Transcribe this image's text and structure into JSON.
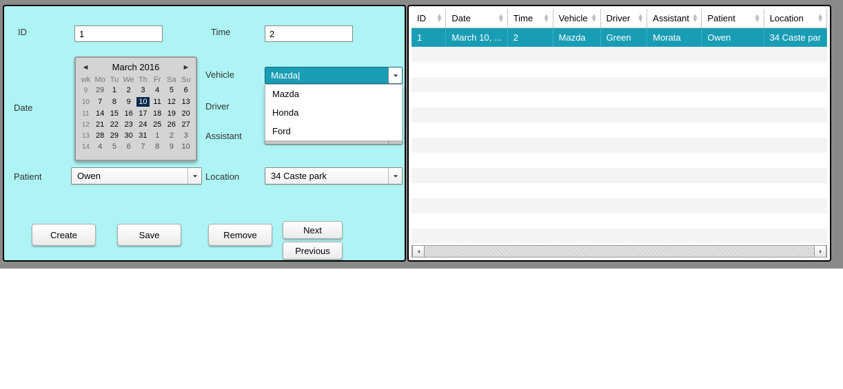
{
  "fields": {
    "id": {
      "label": "ID",
      "value": "1"
    },
    "time": {
      "label": "Time",
      "value": "2"
    },
    "date": {
      "label": "Date"
    },
    "vehicle": {
      "label": "Vehicle",
      "value": "Mazda"
    },
    "driver": {
      "label": "Driver"
    },
    "assistant": {
      "label": "Assistant",
      "value": "Morata"
    },
    "patient": {
      "label": "Patient",
      "value": "Owen"
    },
    "location": {
      "label": "Location",
      "value": "34 Caste park"
    }
  },
  "vehicle_options": [
    "Mazda",
    "Honda",
    "Ford"
  ],
  "calendar": {
    "title": "March 2016",
    "dow": [
      "wk",
      "Mo",
      "Tu",
      "We",
      "Th",
      "Fr",
      "Sa",
      "Su"
    ],
    "rows": [
      {
        "wk": "9",
        "d": [
          "29",
          "1",
          "2",
          "3",
          "4",
          "5",
          "6"
        ],
        "out": [
          0
        ]
      },
      {
        "wk": "10",
        "d": [
          "7",
          "8",
          "9",
          "10",
          "11",
          "12",
          "13"
        ],
        "sel": 3
      },
      {
        "wk": "11",
        "d": [
          "14",
          "15",
          "16",
          "17",
          "18",
          "19",
          "20"
        ]
      },
      {
        "wk": "12",
        "d": [
          "21",
          "22",
          "23",
          "24",
          "25",
          "26",
          "27"
        ]
      },
      {
        "wk": "13",
        "d": [
          "28",
          "29",
          "30",
          "31",
          "1",
          "2",
          "3"
        ],
        "out": [
          4,
          5,
          6
        ]
      },
      {
        "wk": "14",
        "d": [
          "4",
          "5",
          "6",
          "7",
          "8",
          "9",
          "10"
        ],
        "out": [
          0,
          1,
          2,
          3,
          4,
          5,
          6
        ]
      }
    ]
  },
  "buttons": {
    "create": "Create",
    "save": "Save",
    "remove": "Remove",
    "next": "Next",
    "previous": "Previous"
  },
  "grid": {
    "headers": [
      "ID",
      "Date",
      "Time",
      "Vehicle",
      "Driver",
      "Assistant",
      "Patient",
      "Location"
    ],
    "row": [
      "1",
      "March 10, ...",
      "2",
      "Mazda",
      "Green",
      "Morata",
      "Owen",
      "34 Caste par"
    ]
  }
}
